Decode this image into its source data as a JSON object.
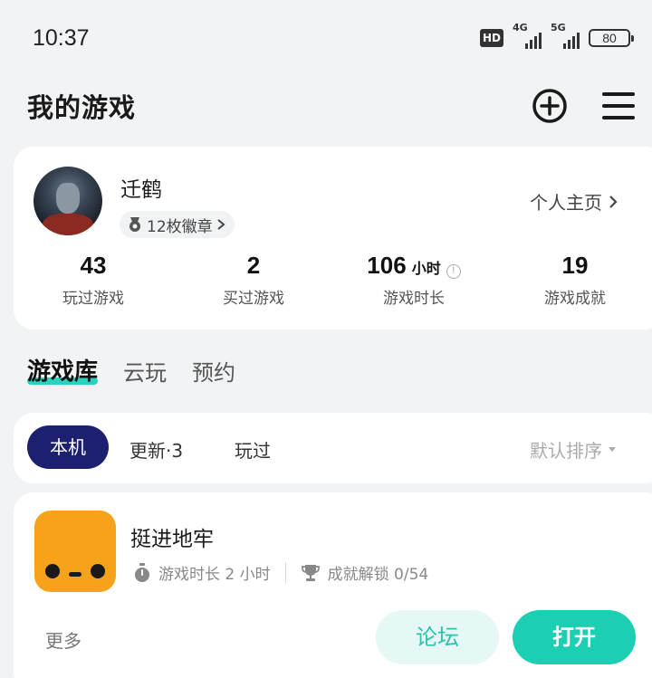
{
  "status_bar": {
    "time": "10:37",
    "hd_label": "HD",
    "net1": "4G",
    "net2": "5G",
    "battery": "80"
  },
  "header": {
    "title": "我的游戏",
    "add_icon": "plus-circle-icon",
    "menu_icon": "hamburger-menu-icon"
  },
  "profile": {
    "username": "迁鹤",
    "badges": "12枚徽章",
    "homepage_link": "个人主页",
    "stats": [
      {
        "value": "43",
        "unit": "",
        "label": "玩过游戏"
      },
      {
        "value": "2",
        "unit": "",
        "label": "买过游戏"
      },
      {
        "value": "106",
        "unit": "小时",
        "label": "游戏时长"
      },
      {
        "value": "19",
        "unit": "",
        "label": "游戏成就"
      }
    ]
  },
  "tabs": [
    {
      "label": "游戏库",
      "active": true
    },
    {
      "label": "云玩",
      "active": false
    },
    {
      "label": "预约",
      "active": false
    }
  ],
  "filters": {
    "chips": [
      "本机",
      "更新·3",
      "玩过"
    ],
    "active_chip": "本机",
    "sort_label": "默认排序"
  },
  "game": {
    "title": "挺进地牢",
    "playtime": "游戏时长 2 小时",
    "achievements": "成就解锁 0/54",
    "more_label": "更多",
    "forum_label": "论坛",
    "open_label": "打开",
    "icon_color": "#f7a21b"
  },
  "colors": {
    "accent": "#1ccfb3",
    "active_chip_bg": "#1d1f70",
    "tab_underline": "#2ad1bf"
  }
}
